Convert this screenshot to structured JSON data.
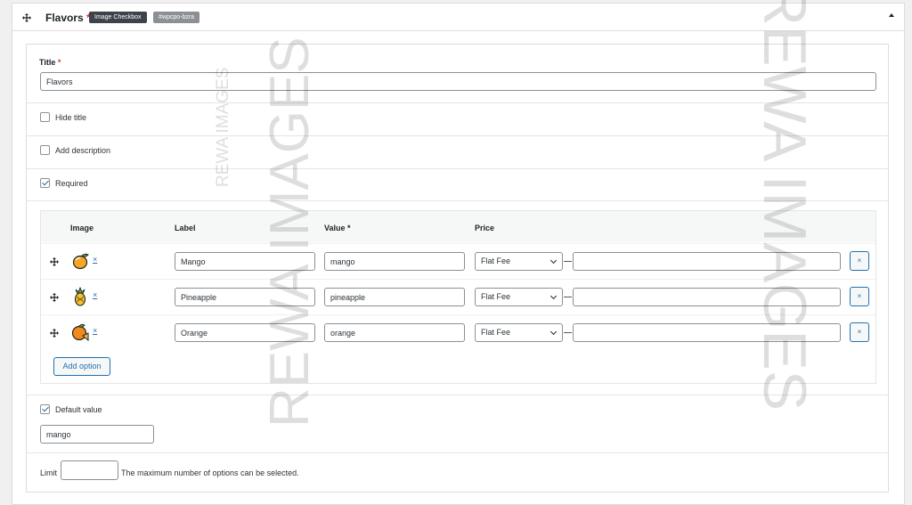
{
  "header": {
    "title": "Flavors",
    "required_mark": "*",
    "type_badge": "Image Checkbox",
    "id_badge": "#wpcpo-bzra"
  },
  "fields": {
    "title_label": "Title",
    "title_required_mark": "*",
    "title_value": "Flavors",
    "hide_title_label": "Hide title",
    "hide_title_checked": false,
    "add_description_label": "Add description",
    "add_description_checked": false,
    "required_label": "Required",
    "required_checked": true
  },
  "options": {
    "columns": {
      "image": "Image",
      "label": "Label",
      "value": "Value *",
      "price": "Price"
    },
    "rows": [
      {
        "image_icon": "mango-icon",
        "remove_image": "×",
        "label": "Mango",
        "value": "mango",
        "price_type": "Flat Fee",
        "price": "",
        "remove": "×"
      },
      {
        "image_icon": "pineapple-icon",
        "remove_image": "×",
        "label": "Pineapple",
        "value": "pineapple",
        "price_type": "Flat Fee",
        "price": "",
        "remove": "×"
      },
      {
        "image_icon": "orange-icon",
        "remove_image": "×",
        "label": "Orange",
        "value": "orange",
        "price_type": "Flat Fee",
        "price": "",
        "remove": "×"
      }
    ],
    "add_option_label": "Add option"
  },
  "default_value": {
    "label": "Default value",
    "checked": true,
    "value": "mango"
  },
  "limit": {
    "label": "Limit",
    "value": "",
    "help": "The maximum number of options can be selected."
  },
  "colors": {
    "accent": "#2271b1",
    "required": "#d63638"
  }
}
